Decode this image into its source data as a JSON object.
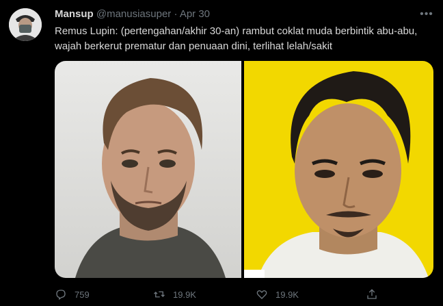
{
  "tweet": {
    "display_name": "Mansup",
    "handle": "@manusiasuper",
    "separator": "·",
    "date": "Apr 30",
    "text": "Remus Lupin: (pertengahan/akhir 30-an) rambut coklat muda berbintik abu-abu, wajah berkerut prematur dan penuaan dini, terlihat lelah/sakit",
    "more_icon": "more-icon",
    "media": [
      {
        "icon": "photo-illustrated-man-portrait"
      },
      {
        "icon": "photo-man-portrait-yellow-background"
      }
    ],
    "actions": {
      "reply_count": "759",
      "retweet_count": "19.9K",
      "like_count": "19.9K"
    }
  },
  "colors": {
    "background": "#000000",
    "text": "#d9d9d9",
    "secondary": "#6e767d",
    "photo_right_bg": "#f2d800"
  }
}
